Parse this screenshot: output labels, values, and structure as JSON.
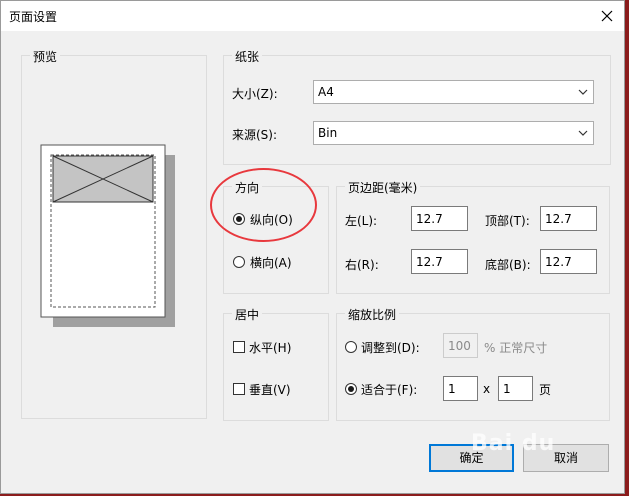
{
  "window": {
    "title": "页面设置"
  },
  "preview": {
    "title": "预览"
  },
  "paper": {
    "title": "纸张",
    "size_label": "大小(Z):",
    "size_value": "A4",
    "source_label": "来源(S):",
    "source_value": "Bin"
  },
  "orientation": {
    "title": "方向",
    "portrait_label": "纵向(O)",
    "landscape_label": "横向(A)",
    "selected": "portrait"
  },
  "margins": {
    "title": "页边距(毫米)",
    "left_label": "左(L):",
    "left_value": "12.7",
    "top_label": "顶部(T):",
    "top_value": "12.7",
    "right_label": "右(R):",
    "right_value": "12.7",
    "bottom_label": "底部(B):",
    "bottom_value": "12.7"
  },
  "centering": {
    "title": "居中",
    "horizontal_label": "水平(H)",
    "vertical_label": "垂直(V)"
  },
  "scaling": {
    "title": "缩放比例",
    "adjust_label": "调整到(D):",
    "adjust_value": "100",
    "adjust_suffix": "% 正常尺寸",
    "fit_label": "适合于(F):",
    "fit_x_value": "1",
    "x_sep": "x",
    "fit_y_value": "1",
    "page_unit": "页",
    "selected": "fit"
  },
  "buttons": {
    "ok": "确定",
    "cancel": "取消"
  },
  "watermark": {
    "text": "Bai du"
  },
  "colors": {
    "accent": "#0078d7",
    "annotation": "#e8383d"
  },
  "icons": {
    "close": "close-icon",
    "dropdown": "chevron-down-icon"
  }
}
